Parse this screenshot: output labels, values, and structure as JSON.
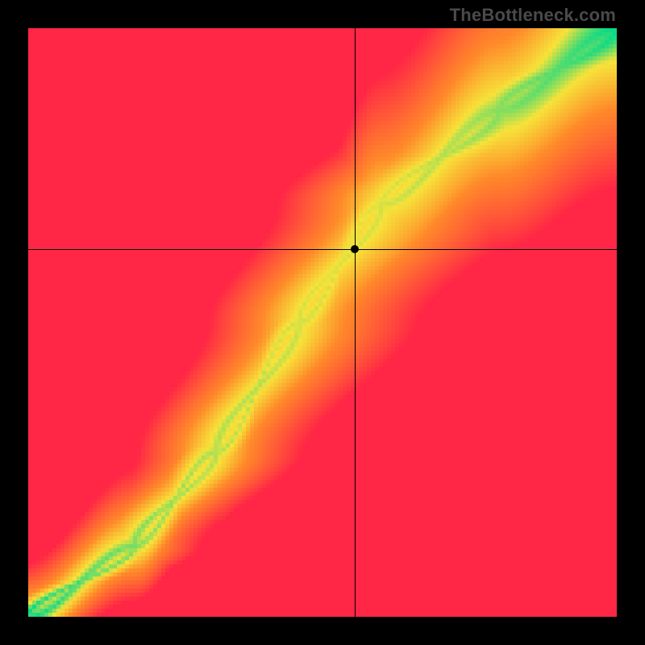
{
  "watermark": "TheBottleneck.com",
  "chart_data": {
    "type": "heatmap",
    "title": "",
    "xlabel": "",
    "ylabel": "",
    "xlim": [
      0,
      1
    ],
    "ylim": [
      0,
      1
    ],
    "crosshair": {
      "x": 0.555,
      "y": 0.625
    },
    "marker": {
      "x": 0.555,
      "y": 0.625
    },
    "optimal_band": {
      "description": "Green ridge of optimal pairing running from bottom-left corner through (0.46,0.50) to top-right, steeper in the lower half",
      "control_points": [
        {
          "x": 0.0,
          "y": 0.0
        },
        {
          "x": 0.18,
          "y": 0.12
        },
        {
          "x": 0.32,
          "y": 0.28
        },
        {
          "x": 0.46,
          "y": 0.5
        },
        {
          "x": 0.6,
          "y": 0.7
        },
        {
          "x": 0.8,
          "y": 0.86
        },
        {
          "x": 1.0,
          "y": 1.0
        }
      ],
      "half_width": 0.045
    },
    "color_scale": {
      "green": "#00d98b",
      "yellow": "#f7e33a",
      "orange": "#ff8a2a",
      "red": "#ff2646"
    },
    "grid": false,
    "legend": false
  }
}
